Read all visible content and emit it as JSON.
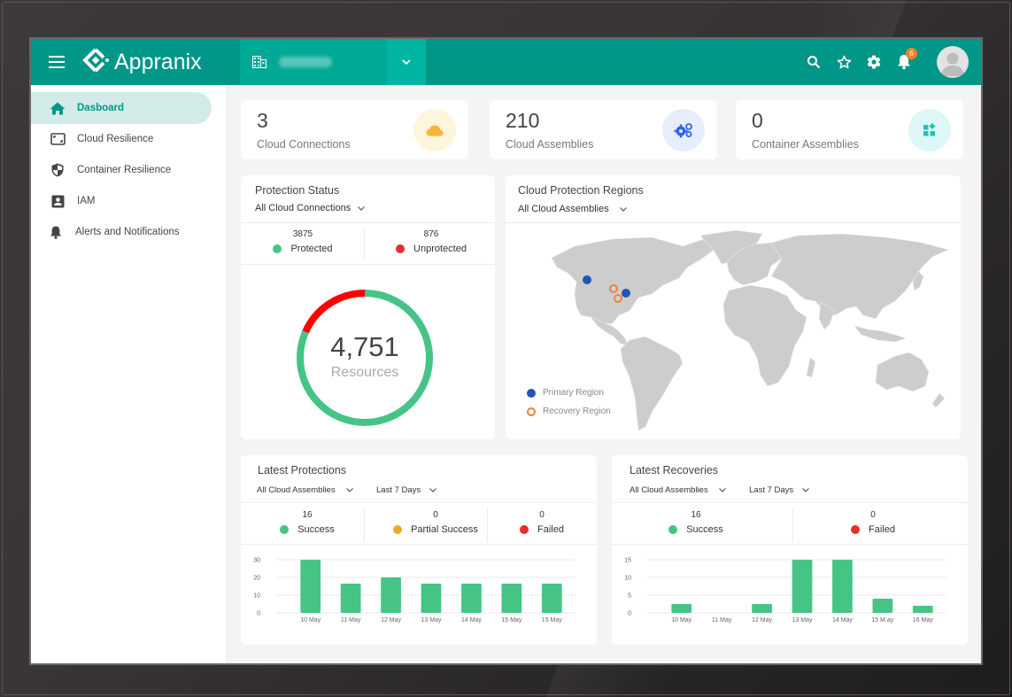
{
  "app": {
    "brand": "Appranix",
    "tenant_name": "",
    "notification_count": "6"
  },
  "header": {
    "icons": [
      "menu-icon",
      "building-icon",
      "chevron-down-icon",
      "search-icon",
      "star-icon",
      "gear-icon",
      "bell-icon",
      "avatar"
    ]
  },
  "sidebar": {
    "items": [
      {
        "label": "Dasboard",
        "icon": "home-icon",
        "active": true
      },
      {
        "label": "Cloud Resilience",
        "icon": "cloud-resilience-icon",
        "active": false
      },
      {
        "label": "Container Resilience",
        "icon": "shield-icon",
        "active": false
      },
      {
        "label": "IAM",
        "icon": "badge-icon",
        "active": false
      },
      {
        "label": "Alerts and Notifications",
        "icon": "bell-icon",
        "active": false
      }
    ]
  },
  "stats": [
    {
      "value": "3",
      "label": "Cloud Connections",
      "icon": "cloud-icon",
      "color": "#fbb534",
      "bg": "#fff5dc"
    },
    {
      "value": "210",
      "label": "Cloud Assemblies",
      "icon": "gears-icon",
      "color": "#2e63e6",
      "bg": "#e6edfd"
    },
    {
      "value": "0",
      "label": "Container Assemblies",
      "icon": "widgets-icon",
      "color": "#1fc4b4",
      "bg": "#dcf7f5"
    }
  ],
  "protection_status": {
    "title": "Protection Status",
    "filter": "All Cloud Connections",
    "protected": {
      "value": "3875",
      "label": "Protected",
      "color": "#45c486"
    },
    "unprotected": {
      "value": "876",
      "label": "Unprotected",
      "color": "#e52e2e"
    },
    "total": "4,751",
    "total_label": "Resources",
    "donut_colors": {
      "protected": "#45c486",
      "unprotected": "#ff0000"
    }
  },
  "regions": {
    "title": "Cloud Protection Regions",
    "filter": "All Cloud Assemblies",
    "legend": [
      {
        "label": "Primary Region",
        "color": "#1f56b3",
        "style": "filled"
      },
      {
        "label": "Recovery Region",
        "color": "#ee7d37",
        "style": "ring"
      }
    ],
    "markers": [
      {
        "type": "primary",
        "place": "US Northwest"
      },
      {
        "type": "primary",
        "place": "US East"
      },
      {
        "type": "recovery",
        "place": "US Midwest"
      },
      {
        "type": "recovery",
        "place": "US Central-East"
      }
    ]
  },
  "latest_protections": {
    "title": "Latest Protections",
    "filter_assemblies": "All Cloud Assemblies",
    "filter_range": "Last 7 Days",
    "kpis": [
      {
        "value": "16",
        "label": "Success",
        "color": "#45c486"
      },
      {
        "value": "0",
        "label": "Partial Success",
        "color": "#f5a623"
      },
      {
        "value": "0",
        "label": "Failed",
        "color": "#e52e2e"
      }
    ]
  },
  "latest_recoveries": {
    "title": "Latest Recoveries",
    "filter_assemblies": "All Cloud Assemblies",
    "filter_range": "Last 7 Days",
    "kpis": [
      {
        "value": "16",
        "label": "Success",
        "color": "#45c486"
      },
      {
        "value": "0",
        "label": "Failed",
        "color": "#e52e2e"
      }
    ]
  },
  "chart_data": [
    {
      "type": "bar",
      "title": "Latest Protections",
      "categories": [
        "10 May",
        "11 May",
        "12 May",
        "13 May",
        "14 May",
        "15 May",
        "15 May"
      ],
      "values": [
        30,
        16.5,
        20,
        16.5,
        16.5,
        16.5,
        16.5
      ],
      "yticks": [
        0,
        10,
        20,
        30
      ],
      "ylim": [
        0,
        30
      ],
      "xlabel": "",
      "ylabel": "",
      "grid": true,
      "color": "#45c486"
    },
    {
      "type": "bar",
      "title": "Latest Recoveries",
      "categories": [
        "10 May",
        "11 May",
        "12 May",
        "13 May",
        "14 May",
        "15 M ay",
        "16 May"
      ],
      "values": [
        2.5,
        0,
        2.5,
        15,
        15,
        4,
        2
      ],
      "yticks": [
        0,
        5,
        10,
        15
      ],
      "ylim": [
        0,
        15
      ],
      "xlabel": "",
      "ylabel": "",
      "grid": true,
      "color": "#45c486"
    }
  ]
}
